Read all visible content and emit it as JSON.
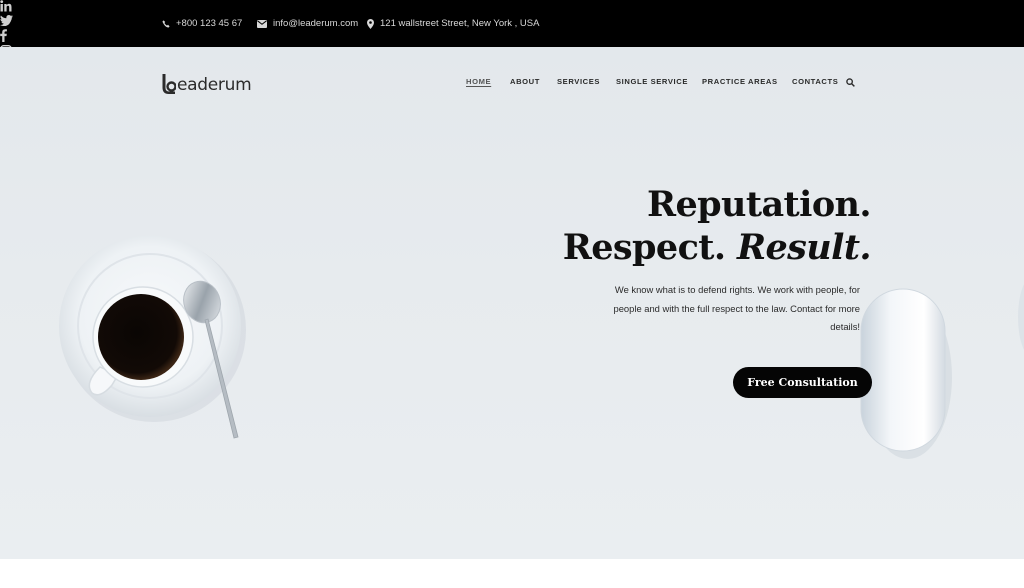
{
  "topbar": {
    "phone": "+800 123 45 67",
    "email": "info@leaderum.com",
    "address": "121 wallstreet Street, New York , USA",
    "social": [
      "linkedin-icon",
      "twitter-icon",
      "facebook-icon",
      "instagram-icon"
    ]
  },
  "header": {
    "logo_text": "eaderum",
    "nav": [
      "HOME",
      "ABOUT",
      "SERVICES",
      "SINGLE SERVICE",
      "PRACTICE AREAS",
      "CONTACTS"
    ],
    "active_nav": "HOME"
  },
  "hero": {
    "headline_line1": "Reputation.",
    "headline_line2_plain": "Respect. ",
    "headline_line2_italic": "Result.",
    "lead": "We know what is to defend rights. We work with people, for people and with the full respect to the law. Contact for more details!",
    "cta_label": "Free Consultation"
  },
  "colors": {
    "topbar_bg": "#000000",
    "hero_bg": "#e6eaed",
    "cta_bg": "#050505",
    "text": "#111111"
  }
}
